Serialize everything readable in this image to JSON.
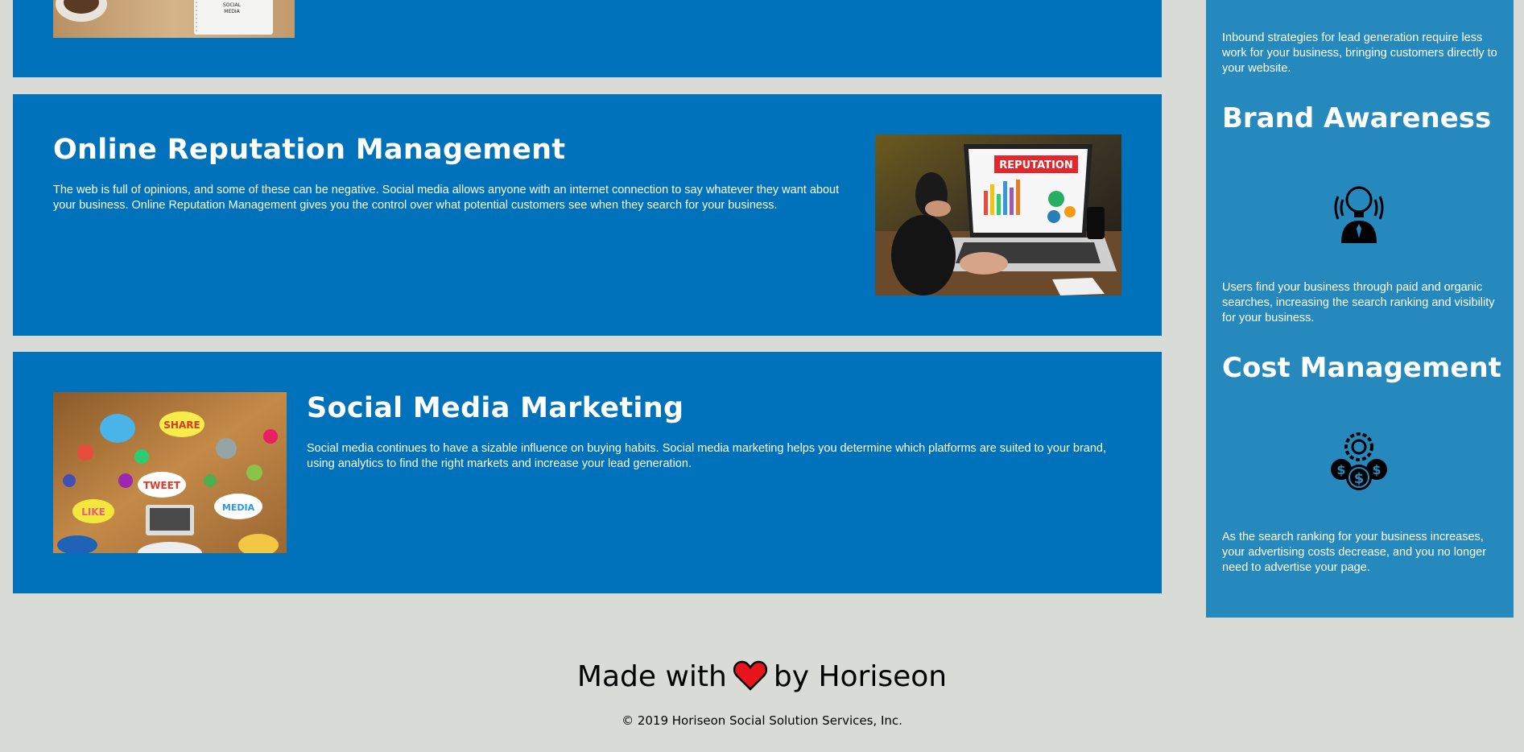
{
  "theme": {
    "page_background": "#d9dcd6",
    "card_background": "#0072bb",
    "sidebar_background": "#2589bd",
    "text_on_blue": "#ffffff",
    "heart_color": "#e8141c"
  },
  "sections": {
    "top": {
      "image_icon": "social-media-notebook-photo"
    },
    "online_reputation": {
      "title": "Online Reputation Management",
      "body": "The web is full of opinions, and some of these can be negative. Social media allows anyone with an internet connection to say whatever they want about your business. Online Reputation Management gives you the control over what potential customers see when they search for your business.",
      "image_icon": "reputation-laptop-photo",
      "image_text": "REPUTATION"
    },
    "social_media_marketing": {
      "title": "Social Media Marketing",
      "body": "Social media continues to have a sizable influence on buying habits. Social media marketing helps you determine which platforms are suited to your brand, using analytics to find the right markets and increase your lead generation.",
      "image_icon": "social-media-table-photo",
      "image_words": [
        "SHARE",
        "TWEET",
        "LIKE",
        "MEDIA"
      ]
    }
  },
  "sidebar": {
    "lead_generation_text": "Inbound strategies for lead generation require less work for your business, bringing customers directly to your website.",
    "brand_awareness": {
      "title": "Brand Awareness",
      "icon": "lightbulb-person-icon",
      "text": "Users find your business through paid and organic searches, increasing the search ranking and visibility for your business."
    },
    "cost_management": {
      "title": "Cost Management",
      "icon": "money-gear-icon",
      "text": "As the search ranking for your business increases, your advertising costs decrease, and you no longer need to advertise your page."
    }
  },
  "footer": {
    "made_with": "Made with",
    "heart_icon": "heart-icon",
    "by": "by Horiseon",
    "copyright": "© 2019 Horiseon Social Solution Services, Inc."
  }
}
